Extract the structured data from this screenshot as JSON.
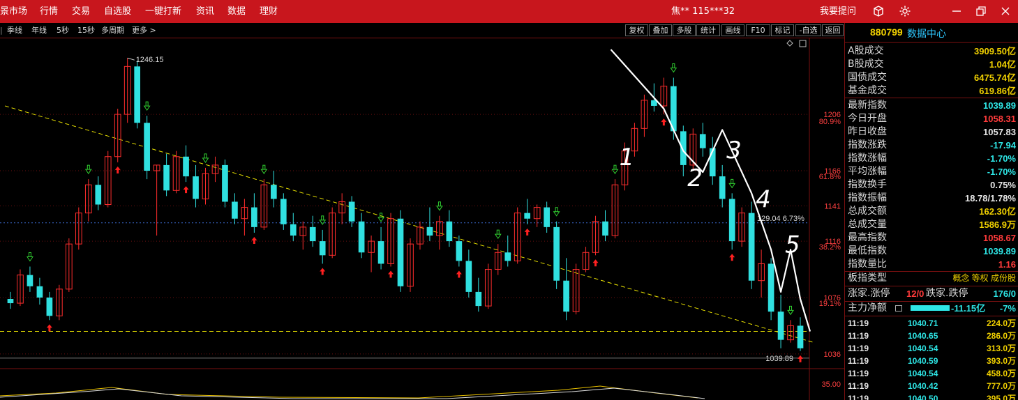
{
  "topbar": {
    "menu": [
      "景市场",
      "行情",
      "交易",
      "自选股",
      "一键打新",
      "资讯",
      "数据",
      "理财"
    ],
    "user": "焦** 115***32",
    "help": "我要提问"
  },
  "toolbar": {
    "left_items": [
      "季线",
      "年线",
      "5秒",
      "15秒",
      "多周期",
      "更多 >"
    ],
    "buttons": [
      "复权",
      "叠加",
      "多股",
      "统计",
      "画线",
      "F10",
      "标记",
      "-自选",
      "返回"
    ]
  },
  "panel": {
    "code": "880799",
    "name": "数据中心",
    "volumes": [
      {
        "label": "A股成交",
        "value": "3909.50亿",
        "color": "yel"
      },
      {
        "label": "B股成交",
        "value": "1.04亿",
        "color": "yel"
      },
      {
        "label": "国债成交",
        "value": "6475.74亿",
        "color": "yel"
      },
      {
        "label": "基金成交",
        "value": "619.86亿",
        "color": "yel"
      }
    ],
    "stats": [
      {
        "label": "最新指数",
        "value": "1039.89",
        "color": "down"
      },
      {
        "label": "今日开盘",
        "value": "1058.31",
        "color": "up"
      },
      {
        "label": "昨日收盘",
        "value": "1057.83",
        "color": "wht"
      },
      {
        "label": "指数涨跌",
        "value": "-17.94",
        "color": "down"
      },
      {
        "label": "指数涨幅",
        "value": "-1.70%",
        "color": "down"
      },
      {
        "label": "平均涨幅",
        "value": "-1.70%",
        "color": "down"
      },
      {
        "label": "指数换手",
        "value": "0.75%",
        "color": "wht"
      },
      {
        "label": "指数振幅",
        "value": "18.78/1.78%",
        "color": "wht"
      },
      {
        "label": "总成交额",
        "value": "162.30亿",
        "color": "yel"
      },
      {
        "label": "总成交量",
        "value": "1586.9万",
        "color": "yel"
      },
      {
        "label": "最高指数",
        "value": "1058.67",
        "color": "up"
      },
      {
        "label": "最低指数",
        "value": "1039.89",
        "color": "down"
      },
      {
        "label": "指数量比",
        "value": "1.16",
        "color": "up"
      }
    ],
    "type_label": "板指类型",
    "type_values": "概念 等权 成份股",
    "limit_up_label": "涨家.涨停",
    "limit_up_value": "12/0",
    "limit_down_label": "跌家.跌停",
    "limit_down_value": "176/0",
    "flow_label": "主力净额",
    "flow_value": "-11.15亿",
    "flow_pct": "-7%",
    "ticks": [
      {
        "time": "11:19",
        "price": "1040.71",
        "vol": "224.0万"
      },
      {
        "time": "11:19",
        "price": "1040.65",
        "vol": "286.0万"
      },
      {
        "time": "11:19",
        "price": "1040.54",
        "vol": "313.0万"
      },
      {
        "time": "11:19",
        "price": "1040.59",
        "vol": "393.0万"
      },
      {
        "time": "11:19",
        "price": "1040.54",
        "vol": "458.0万"
      },
      {
        "time": "11:19",
        "price": "1040.42",
        "vol": "777.0万"
      },
      {
        "time": "11:19",
        "price": "1040.50",
        "vol": "395.0万"
      }
    ]
  },
  "chart_data": {
    "type": "candlestick",
    "y_range": [
      1030,
      1255
    ],
    "y_ticks": [
      "1206",
      "1166",
      "1141",
      "1116",
      "1076",
      "1036"
    ],
    "pct_ticks": [
      {
        "label": "80.9%",
        "value": 1201
      },
      {
        "label": "61.8%",
        "value": 1162
      },
      {
        "label": "38.2%",
        "value": 1112
      },
      {
        "label": "19.1%",
        "value": 1072
      }
    ],
    "volume_tick": "35.00",
    "high_label": "1246.15",
    "low_label": "1039.89",
    "crosshair_label": "129.04 6.73%",
    "crosshair_value": 1129,
    "support_level": 1052,
    "trendline": {
      "from_index": 0,
      "from_value": 1212,
      "to_index": 81,
      "to_value": 1046
    },
    "candles": [
      [
        1075,
        1080,
        1068,
        1072
      ],
      [
        1072,
        1096,
        1070,
        1092
      ],
      [
        1092,
        1098,
        1080,
        1084
      ],
      [
        1084,
        1090,
        1071,
        1076
      ],
      [
        1076,
        1080,
        1060,
        1063
      ],
      [
        1063,
        1085,
        1060,
        1082
      ],
      [
        1082,
        1118,
        1080,
        1114
      ],
      [
        1114,
        1140,
        1110,
        1136
      ],
      [
        1136,
        1160,
        1130,
        1156
      ],
      [
        1156,
        1162,
        1138,
        1142
      ],
      [
        1142,
        1180,
        1140,
        1176
      ],
      [
        1176,
        1210,
        1172,
        1206
      ],
      [
        1206,
        1246,
        1200,
        1240
      ],
      [
        1240,
        1244,
        1196,
        1200
      ],
      [
        1200,
        1205,
        1160,
        1166
      ],
      [
        1166,
        1170,
        1120,
        1170
      ],
      [
        1170,
        1178,
        1148,
        1152
      ],
      [
        1152,
        1180,
        1150,
        1176
      ],
      [
        1176,
        1184,
        1158,
        1162
      ],
      [
        1162,
        1170,
        1140,
        1146
      ],
      [
        1146,
        1168,
        1142,
        1164
      ],
      [
        1164,
        1176,
        1158,
        1170
      ],
      [
        1170,
        1174,
        1140,
        1144
      ],
      [
        1144,
        1150,
        1128,
        1132
      ],
      [
        1132,
        1146,
        1120,
        1140
      ],
      [
        1140,
        1150,
        1122,
        1126
      ],
      [
        1126,
        1160,
        1124,
        1156
      ],
      [
        1156,
        1166,
        1140,
        1146
      ],
      [
        1146,
        1150,
        1124,
        1128
      ],
      [
        1128,
        1136,
        1116,
        1120
      ],
      [
        1120,
        1130,
        1110,
        1126
      ],
      [
        1126,
        1134,
        1112,
        1116
      ],
      [
        1116,
        1124,
        1100,
        1106
      ],
      [
        1106,
        1140,
        1104,
        1136
      ],
      [
        1136,
        1150,
        1128,
        1144
      ],
      [
        1144,
        1148,
        1126,
        1130
      ],
      [
        1130,
        1136,
        1104,
        1108
      ],
      [
        1108,
        1120,
        1094,
        1116
      ],
      [
        1116,
        1126,
        1096,
        1100
      ],
      [
        1100,
        1136,
        1098,
        1132
      ],
      [
        1132,
        1138,
        1080,
        1084
      ],
      [
        1084,
        1118,
        1080,
        1114
      ],
      [
        1114,
        1130,
        1110,
        1126
      ],
      [
        1126,
        1140,
        1116,
        1120
      ],
      [
        1120,
        1134,
        1110,
        1130
      ],
      [
        1130,
        1138,
        1112,
        1116
      ],
      [
        1116,
        1120,
        1098,
        1102
      ],
      [
        1102,
        1110,
        1076,
        1080
      ],
      [
        1080,
        1090,
        1066,
        1070
      ],
      [
        1070,
        1100,
        1068,
        1096
      ],
      [
        1096,
        1114,
        1092,
        1108
      ],
      [
        1108,
        1120,
        1098,
        1102
      ],
      [
        1102,
        1140,
        1100,
        1136
      ],
      [
        1136,
        1146,
        1128,
        1132
      ],
      [
        1132,
        1142,
        1126,
        1140
      ],
      [
        1140,
        1144,
        1122,
        1126
      ],
      [
        1126,
        1130,
        1082,
        1088
      ],
      [
        1088,
        1104,
        1060,
        1066
      ],
      [
        1066,
        1100,
        1064,
        1096
      ],
      [
        1096,
        1112,
        1094,
        1108
      ],
      [
        1108,
        1134,
        1106,
        1130
      ],
      [
        1130,
        1138,
        1116,
        1120
      ],
      [
        1120,
        1160,
        1118,
        1156
      ],
      [
        1156,
        1186,
        1152,
        1180
      ],
      [
        1180,
        1200,
        1176,
        1196
      ],
      [
        1196,
        1220,
        1190,
        1216
      ],
      [
        1216,
        1228,
        1208,
        1212
      ],
      [
        1212,
        1232,
        1206,
        1226
      ],
      [
        1226,
        1232,
        1188,
        1194
      ],
      [
        1194,
        1198,
        1162,
        1170
      ],
      [
        1170,
        1196,
        1166,
        1192
      ],
      [
        1192,
        1200,
        1176,
        1182
      ],
      [
        1182,
        1190,
        1156,
        1162
      ],
      [
        1162,
        1170,
        1140,
        1146
      ],
      [
        1146,
        1150,
        1110,
        1116
      ],
      [
        1116,
        1140,
        1112,
        1136
      ],
      [
        1136,
        1144,
        1082,
        1088
      ],
      [
        1088,
        1110,
        1076,
        1100
      ],
      [
        1100,
        1104,
        1060,
        1066
      ],
      [
        1066,
        1078,
        1040,
        1046
      ],
      [
        1046,
        1060,
        1044,
        1056
      ],
      [
        1056,
        1062,
        1038,
        1040
      ]
    ],
    "annotations": [
      "1",
      "2",
      "3",
      "4",
      "5"
    ]
  }
}
